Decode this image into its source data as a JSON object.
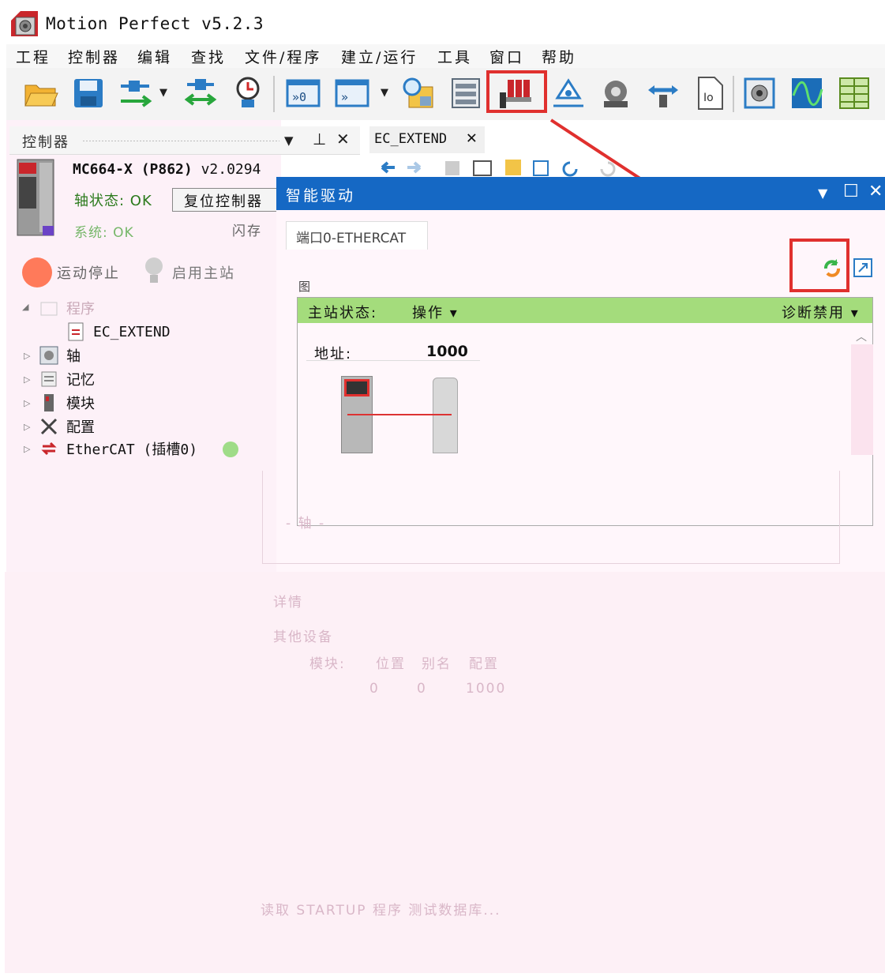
{
  "app": {
    "title": "Motion Perfect v5.2.3"
  },
  "menu": {
    "items": [
      "工程",
      "控制器",
      "编辑",
      "查找",
      "文件/程序",
      "建立/运行",
      "工具",
      "窗口",
      "帮助"
    ]
  },
  "toolbar": {
    "buttons": [
      "folder-open-icon",
      "save-icon",
      "connect-icon",
      "disconnect-icon",
      "clock-icon",
      "terminal-icon",
      "terminal-dropdown-icon",
      "search-icon",
      "memory-icon",
      "intelligent-drives-icon",
      "axis-icon",
      "robot-icon",
      "motion-icon",
      "file-icon",
      "axis-params-icon",
      "scope-icon",
      "table-icon"
    ],
    "highlight_color": "#e0302e"
  },
  "controller_panel": {
    "title": "控制器",
    "model": "MC664-X  (P862)",
    "version": "v2.0294",
    "axis_status": "轴状态: OK",
    "reset_button": "复位控制器",
    "system_status": "系统: OK",
    "flash_label": "闪存",
    "stop_label": "运动停止",
    "master_label": "启用主站",
    "tree": {
      "root_label": "程序",
      "items": [
        {
          "label": "EC_EXTEND",
          "icon": "program-icon"
        },
        {
          "label": "轴",
          "icon": "axis-icon"
        },
        {
          "label": "记忆",
          "icon": "memory-icon"
        },
        {
          "label": "模块",
          "icon": "module-icon"
        },
        {
          "label": "配置",
          "icon": "tools-icon"
        },
        {
          "label": "EtherCAT (插槽0)",
          "icon": "ethercat-icon"
        }
      ]
    },
    "ethercat_status_color": "#9fdc88"
  },
  "editor_tab": {
    "label": "EC_EXTEND"
  },
  "smart_drive": {
    "title": "智能驱动",
    "port_tab": "端口0-ETHERCAT",
    "graph_tab": "图",
    "master_state_label": "主站状态:",
    "master_state_value": "操作 ▾",
    "diag_label": "诊断禁用 ▾",
    "address_label": "地址:",
    "address_value": "1000",
    "title_color": "#1568c4",
    "status_color": "#a4dc7c"
  },
  "faded": {
    "axis_label": "- 轴 -",
    "details": "详情",
    "other_devices": "其他设备",
    "table_headers": [
      "模块:",
      "位置",
      "别名",
      "配置"
    ],
    "table_values": [
      "0",
      "0",
      "1000"
    ],
    "footer": "读取 STARTUP 程序    测试数据库..."
  }
}
